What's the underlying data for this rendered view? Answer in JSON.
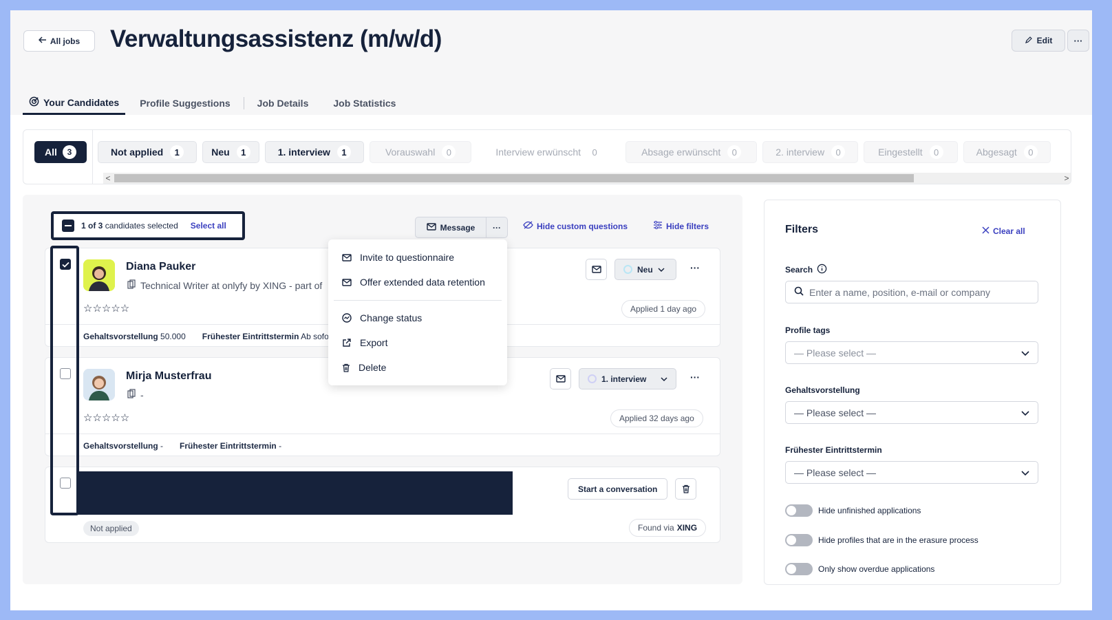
{
  "header": {
    "back_label": "All jobs",
    "title": "Verwaltungsassistenz (m/w/d)",
    "edit_label": "Edit",
    "more_label": "···"
  },
  "tabs": [
    {
      "label": "Your Candidates",
      "active": true
    },
    {
      "label": "Profile Suggestions"
    },
    {
      "label": "Job Details"
    },
    {
      "label": "Job Statistics"
    }
  ],
  "status_filter": {
    "all": {
      "label": "All",
      "count": "3"
    },
    "pills": [
      {
        "label": "Not applied",
        "count": "1"
      },
      {
        "label": "Neu",
        "count": "1"
      },
      {
        "label": "1. interview",
        "count": "1"
      },
      {
        "label": "Vorauswahl",
        "count": "0"
      },
      {
        "label": "Interview erwünscht",
        "count": "0"
      },
      {
        "label": "Absage erwünscht",
        "count": "0"
      },
      {
        "label": "2. interview",
        "count": "0"
      },
      {
        "label": "Eingestellt",
        "count": "0"
      },
      {
        "label": "Abgesagt",
        "count": "0"
      }
    ],
    "scroll_left": "<",
    "scroll_right": ">"
  },
  "toolbar": {
    "selection_count": "1 of 3",
    "selection_suffix": "candidates selected",
    "select_all": "Select all",
    "message_label": "Message",
    "message_more": "···",
    "hide_custom_questions": "Hide custom questions",
    "hide_filters": "Hide filters"
  },
  "bulk_menu": {
    "items": [
      {
        "label": "Invite to questionnaire",
        "icon": "mail-icon"
      },
      {
        "label": "Offer extended data retention",
        "icon": "mail-icon"
      },
      {
        "label": "Change status",
        "icon": "status-icon"
      },
      {
        "label": "Export",
        "icon": "external-link-icon"
      },
      {
        "label": "Delete",
        "icon": "trash-icon"
      }
    ]
  },
  "candidates": [
    {
      "name": "Diana Pauker",
      "subtitle": "Technical Writer at onlyfy by XING - part of",
      "stars": "☆☆☆☆☆",
      "status": "Neu",
      "applied": "Applied 1 day ago",
      "salary_label": "Gehaltsvorstellung",
      "salary_value": "50.000",
      "start_label": "Frühester Eintrittstermin",
      "start_value": "Ab sofo",
      "checked": true
    },
    {
      "name": "Mirja Musterfrau",
      "subtitle": "-",
      "stars": "☆☆☆☆☆",
      "status": "1. interview",
      "applied": "Applied 32 days ago",
      "salary_label": "Gehaltsvorstellung",
      "salary_value": "-",
      "start_label": "Frühester Eintrittstermin",
      "start_value": "-",
      "checked": false
    },
    {
      "start_conversation": "Start a conversation",
      "badge": "Not applied",
      "found_via_prefix": "Found via",
      "found_via_source": "XING",
      "checked": false
    }
  ],
  "filters": {
    "title": "Filters",
    "clear_all": "Clear all",
    "search_label": "Search",
    "search_placeholder": "Enter a name, position, e-mail or company",
    "profile_tags_label": "Profile tags",
    "profile_tags_placeholder": "— Please select —",
    "salary_label": "Gehaltsvorstellung",
    "salary_placeholder": "— Please select —",
    "start_label": "Frühester Eintrittstermin",
    "start_placeholder": "— Please select —",
    "toggles": [
      {
        "label": "Hide unfinished applications",
        "on": false
      },
      {
        "label": "Hide profiles that are in the erasure process",
        "on": false
      },
      {
        "label": "Only show overdue applications",
        "on": false
      }
    ]
  },
  "colors": {
    "navy": "#16223b",
    "accent_link": "#3a3fbf",
    "page_border": "#9db9f6"
  }
}
